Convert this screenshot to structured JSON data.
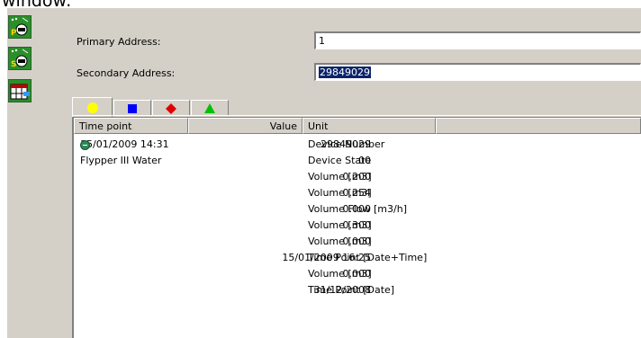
{
  "caption": "window:",
  "sidebar": {
    "buttons": [
      {
        "text": "P"
      },
      {
        "text": "S"
      },
      {
        "text": ""
      }
    ]
  },
  "form": {
    "primary_label": "Primary Address:",
    "primary_value": "1",
    "secondary_label": "Secondary Address:",
    "secondary_value": "29849029"
  },
  "tabs": [
    {
      "icon": "yellow-circle-icon",
      "color": "#ffff00",
      "active": true
    },
    {
      "icon": "blue-square-icon",
      "color": "#0000ff"
    },
    {
      "icon": "red-diamond-icon",
      "color": "#e00000"
    },
    {
      "icon": "green-triangle-icon",
      "color": "#00c000"
    }
  ],
  "table": {
    "headers": {
      "time": "Time point",
      "value": "Value",
      "unit": "Unit"
    },
    "rows": [
      {
        "time": "15/01/2009 14:31",
        "value": "29849029",
        "unit": "Device Number",
        "icon": true
      },
      {
        "time": "Flypper III Water",
        "value": "00",
        "unit": "Device State"
      },
      {
        "time": "",
        "value": "0.200",
        "unit": "Volume [m3]"
      },
      {
        "time": "",
        "value": "0.254",
        "unit": "Volume [m3]"
      },
      {
        "time": "",
        "value": "0.000",
        "unit": "Volume Flow [m3/h]"
      },
      {
        "time": "",
        "value": "0.300",
        "unit": "Volume [m3]"
      },
      {
        "time": "",
        "value": "0.000",
        "unit": "Volume [m3]"
      },
      {
        "time": "",
        "value": "15/01/2009 16:25",
        "unit": "Time Point [Date+Time]"
      },
      {
        "time": "",
        "value": "0.000",
        "unit": "Volume [m3]"
      },
      {
        "time": "",
        "value": "31/12/2008",
        "unit": "Time Point [Date]"
      }
    ]
  }
}
